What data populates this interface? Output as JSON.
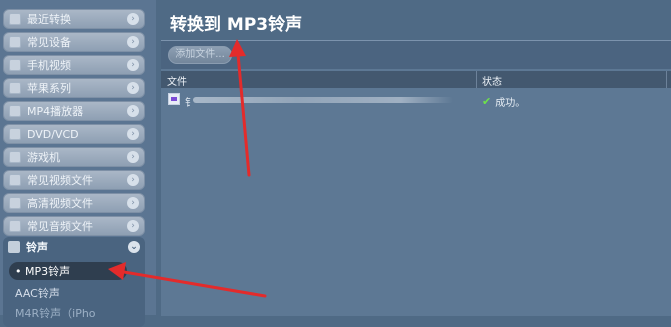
{
  "sidebar": {
    "items": [
      {
        "label": "最近转换",
        "icon": "recent-icon"
      },
      {
        "label": "常见设备",
        "icon": "device-icon"
      },
      {
        "label": "手机视频",
        "icon": "phone-icon"
      },
      {
        "label": "苹果系列",
        "icon": "apple-icon"
      },
      {
        "label": "MP4播放器",
        "icon": "mp4-player-icon"
      },
      {
        "label": "DVD/VCD",
        "icon": "disc-icon"
      },
      {
        "label": "游戏机",
        "icon": "game-console-icon"
      },
      {
        "label": "常见视频文件",
        "icon": "video-file-icon"
      },
      {
        "label": "高清视频文件",
        "icon": "hd-video-icon"
      },
      {
        "label": "常见音频文件",
        "icon": "audio-file-icon"
      }
    ],
    "open_section": {
      "label": "铃声",
      "icon": "ringtone-icon",
      "items": [
        {
          "label": "• MP3铃声"
        },
        {
          "label": "AAC铃声"
        },
        {
          "label": "M4R铃声（iPho"
        }
      ]
    }
  },
  "main": {
    "title": "转换到 MP3铃声",
    "toolbar": {
      "add_label": "添加文件..."
    },
    "table": {
      "headers": [
        "文件",
        "状态"
      ],
      "rows": [
        {
          "file": "钅",
          "status": "成功。"
        }
      ]
    }
  },
  "colors": {
    "background": "#4f6a85",
    "panel": "#5d7894",
    "selected": "#2f3e4f",
    "success": "#6ee34a",
    "annotation_arrow": "#e32b2b"
  }
}
